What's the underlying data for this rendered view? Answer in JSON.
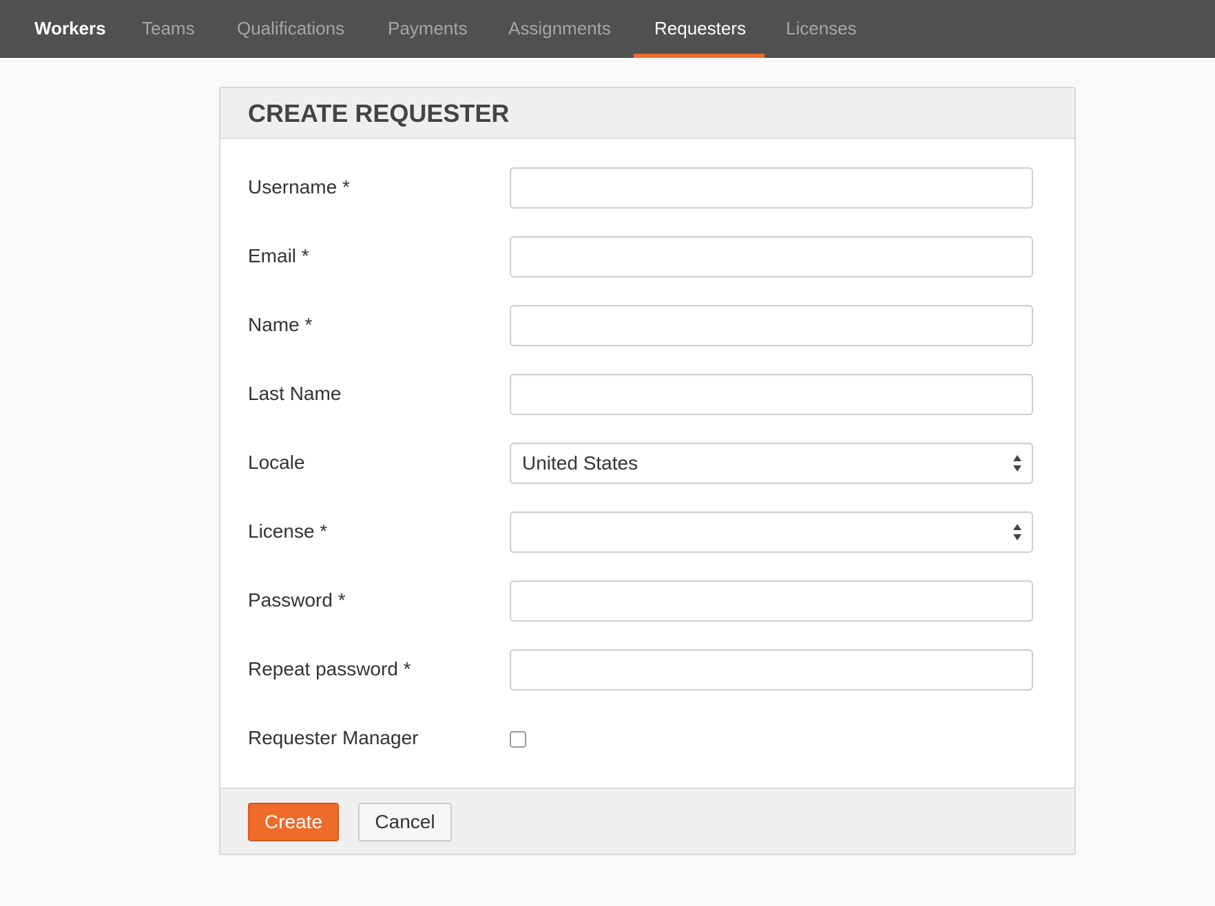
{
  "nav": {
    "items": [
      {
        "label": "Workers"
      },
      {
        "label": "Teams"
      },
      {
        "label": "Qualifications"
      },
      {
        "label": "Payments"
      },
      {
        "label": "Assignments"
      },
      {
        "label": "Requesters"
      },
      {
        "label": "Licenses"
      }
    ],
    "active": "Requesters"
  },
  "panel": {
    "title": "CREATE REQUESTER"
  },
  "form": {
    "username": {
      "label": "Username *",
      "value": ""
    },
    "email": {
      "label": "Email *",
      "value": ""
    },
    "name": {
      "label": "Name *",
      "value": ""
    },
    "last_name": {
      "label": "Last Name",
      "value": ""
    },
    "locale": {
      "label": "Locale",
      "selected": "United States"
    },
    "license": {
      "label": "License *",
      "selected": ""
    },
    "password": {
      "label": "Password *",
      "value": ""
    },
    "repeat_password": {
      "label": "Repeat password *",
      "value": ""
    },
    "requester_manager": {
      "label": "Requester Manager",
      "checked": false
    }
  },
  "footer": {
    "create_label": "Create",
    "cancel_label": "Cancel"
  },
  "colors": {
    "accent": "#ee6b2a",
    "navbar": "#505050"
  }
}
